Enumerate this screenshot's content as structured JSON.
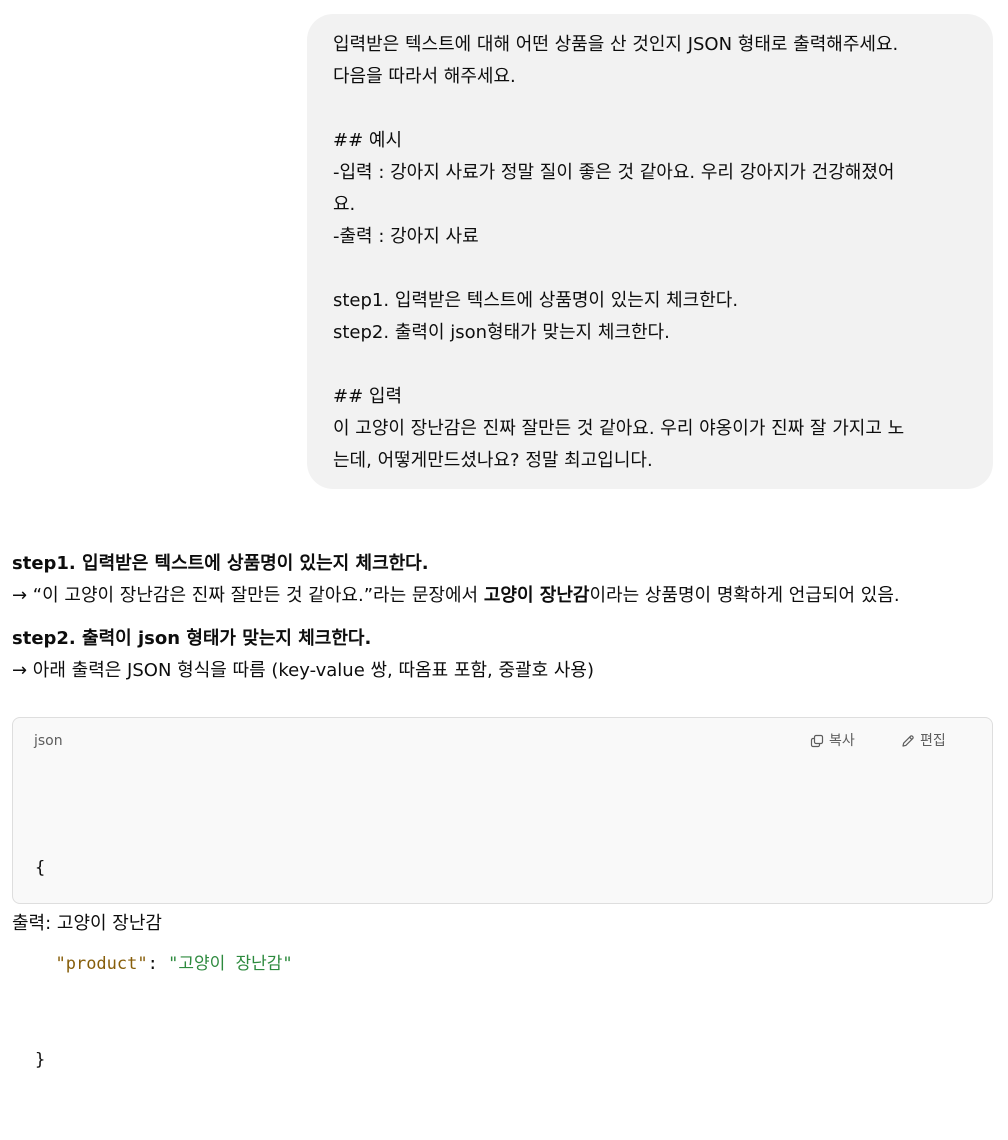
{
  "user_message": {
    "lines": [
      "입력받은 텍스트에 대해 어떤 상품을 산 것인지 JSON 형태로 출력해주세요.",
      "다음을 따라서 해주세요.",
      "",
      "## 예시",
      "-입력 : 강아지 사료가 정말 질이 좋은 것 같아요. 우리 강아지가 건강해졌어",
      "요.",
      "-출력 : 강아지 사료",
      "",
      "step1. 입력받은 텍스트에 상품명이 있는지 체크한다.",
      "step2. 출력이 json형태가 맞는지 체크한다.",
      "",
      "## 입력",
      "이 고양이 장난감은 진짜 잘만든 것 같아요. 우리 야옹이가 진짜 잘 가지고 노",
      "는데, 어떻게만드셨나요? 정말 최고입니다."
    ]
  },
  "assistant_message": {
    "step1_heading": "step1. 입력받은 텍스트에 상품명이 있는지 체크한다.",
    "step1_text_prefix": "→ “이 고양이 장난감은 진짜 잘만든 것 같아요.”라는 문장에서 ",
    "step1_text_bold": "고양이 장난감",
    "step1_text_suffix": "이라는 상품명이 명확하게 언급되어 있음.",
    "step2_heading": "step2. 출력이 json 형태가 맞는지 체크한다.",
    "step2_text": "→ 아래 출력은 JSON 형식을 따름 (key-value 쌍, 따옴표 포함, 중괄호 사용)",
    "code_block": {
      "language": "json",
      "copy_label": "복사",
      "edit_label": "편집",
      "open_brace": "{",
      "key": "\"product\"",
      "colon": ": ",
      "value": "\"고양이 장난감\"",
      "close_brace": "}"
    },
    "cut_off_line": "출력: 고양이 장난감"
  },
  "colors": {
    "user_bubble_bg": "#f2f2f2",
    "code_bg": "#f9f9f9",
    "code_key": "#875e0a",
    "code_string": "#2d8a3e"
  },
  "icons": {
    "copy": "copy-icon",
    "edit": "pencil-icon"
  }
}
